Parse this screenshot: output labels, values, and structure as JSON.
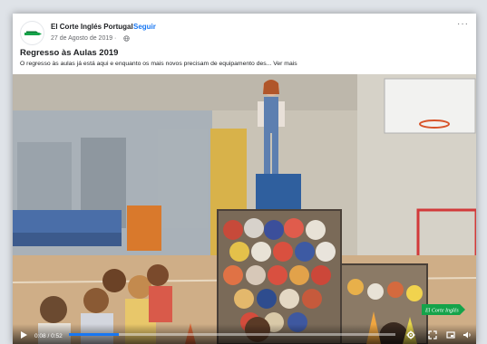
{
  "post": {
    "page_name": "El Corte Inglés Portugal",
    "separator": "·",
    "follow_label": "Seguir",
    "date": "27 de Agosto de 2019 ·",
    "more_label": "···",
    "title": "Regresso às Aulas 2019",
    "description": "O regresso às aulas já está aqui e enquanto os mais novos precisam de equipamento des... Ver mais"
  },
  "video": {
    "time": "0:08 / 0:52",
    "progress": 0.154,
    "watermark_text": "El Corte Inglés"
  },
  "colors": {
    "brand_green": "#15a34a",
    "link_blue": "#1877f2"
  },
  "icons": [
    "brand-logo-icon",
    "globe-icon",
    "play-icon",
    "settings-icon",
    "fullscreen-icon",
    "pip-icon",
    "volume-icon"
  ]
}
